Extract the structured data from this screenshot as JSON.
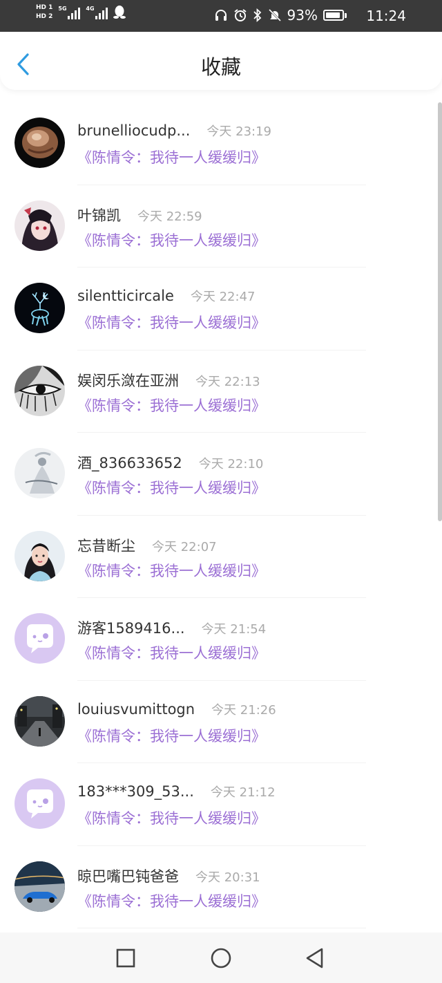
{
  "status_bar": {
    "hd1": "HD 1",
    "hd2": "HD 2",
    "net1": "5G",
    "net2": "4G",
    "battery_percent": "93%",
    "battery_level": 0.93,
    "time": "11:24",
    "icons": [
      "headphones-icon",
      "alarm-icon",
      "bluetooth-icon",
      "mute-icon",
      "battery-icon",
      "qq-icon"
    ]
  },
  "header": {
    "title": "收藏",
    "back_icon": "chevron-left-icon",
    "accent_color": "#2f9be0"
  },
  "list": {
    "work_color": "#9b6fd4",
    "items": [
      {
        "name": "brunelliocudp...",
        "time": "今天 23:19",
        "work": "《陈情令：我待一人缓缓归》",
        "avatar": "snail"
      },
      {
        "name": "叶锦凯",
        "time": "今天 22:59",
        "work": "《陈情令：我待一人缓缓归》",
        "avatar": "anime-mask"
      },
      {
        "name": "silentticircale",
        "time": "今天 22:47",
        "work": "《陈情令：我待一人缓缓归》",
        "avatar": "deer"
      },
      {
        "name": "娱闵乐潋在亚洲",
        "time": "今天 22:13",
        "work": "《陈情令：我待一人缓缓归》",
        "avatar": "eye"
      },
      {
        "name": "酒_836633652",
        "time": "今天 22:10",
        "work": "《陈情令：我待一人缓缓归》",
        "avatar": "ink-figure"
      },
      {
        "name": "忘昔断尘",
        "time": "今天 22:07",
        "work": "《陈情令：我待一人缓缓归》",
        "avatar": "portrait"
      },
      {
        "name": "游客1589416...",
        "time": "今天 21:54",
        "work": "《陈情令：我待一人缓缓归》",
        "avatar": "default"
      },
      {
        "name": "louiusvumittogn",
        "time": "今天 21:26",
        "work": "《陈情令：我待一人缓缓归》",
        "avatar": "street"
      },
      {
        "name": "183***309_53...",
        "time": "今天 21:12",
        "work": "《陈情令：我待一人缓缓归》",
        "avatar": "default"
      },
      {
        "name": "晾巴嘴巴钝爸爸",
        "time": "今天 20:31",
        "work": "《陈情令：我待一人缓缓归》",
        "avatar": "car"
      }
    ]
  },
  "navbar": {
    "icons": [
      "recents-square-icon",
      "home-circle-icon",
      "back-triangle-icon"
    ]
  }
}
